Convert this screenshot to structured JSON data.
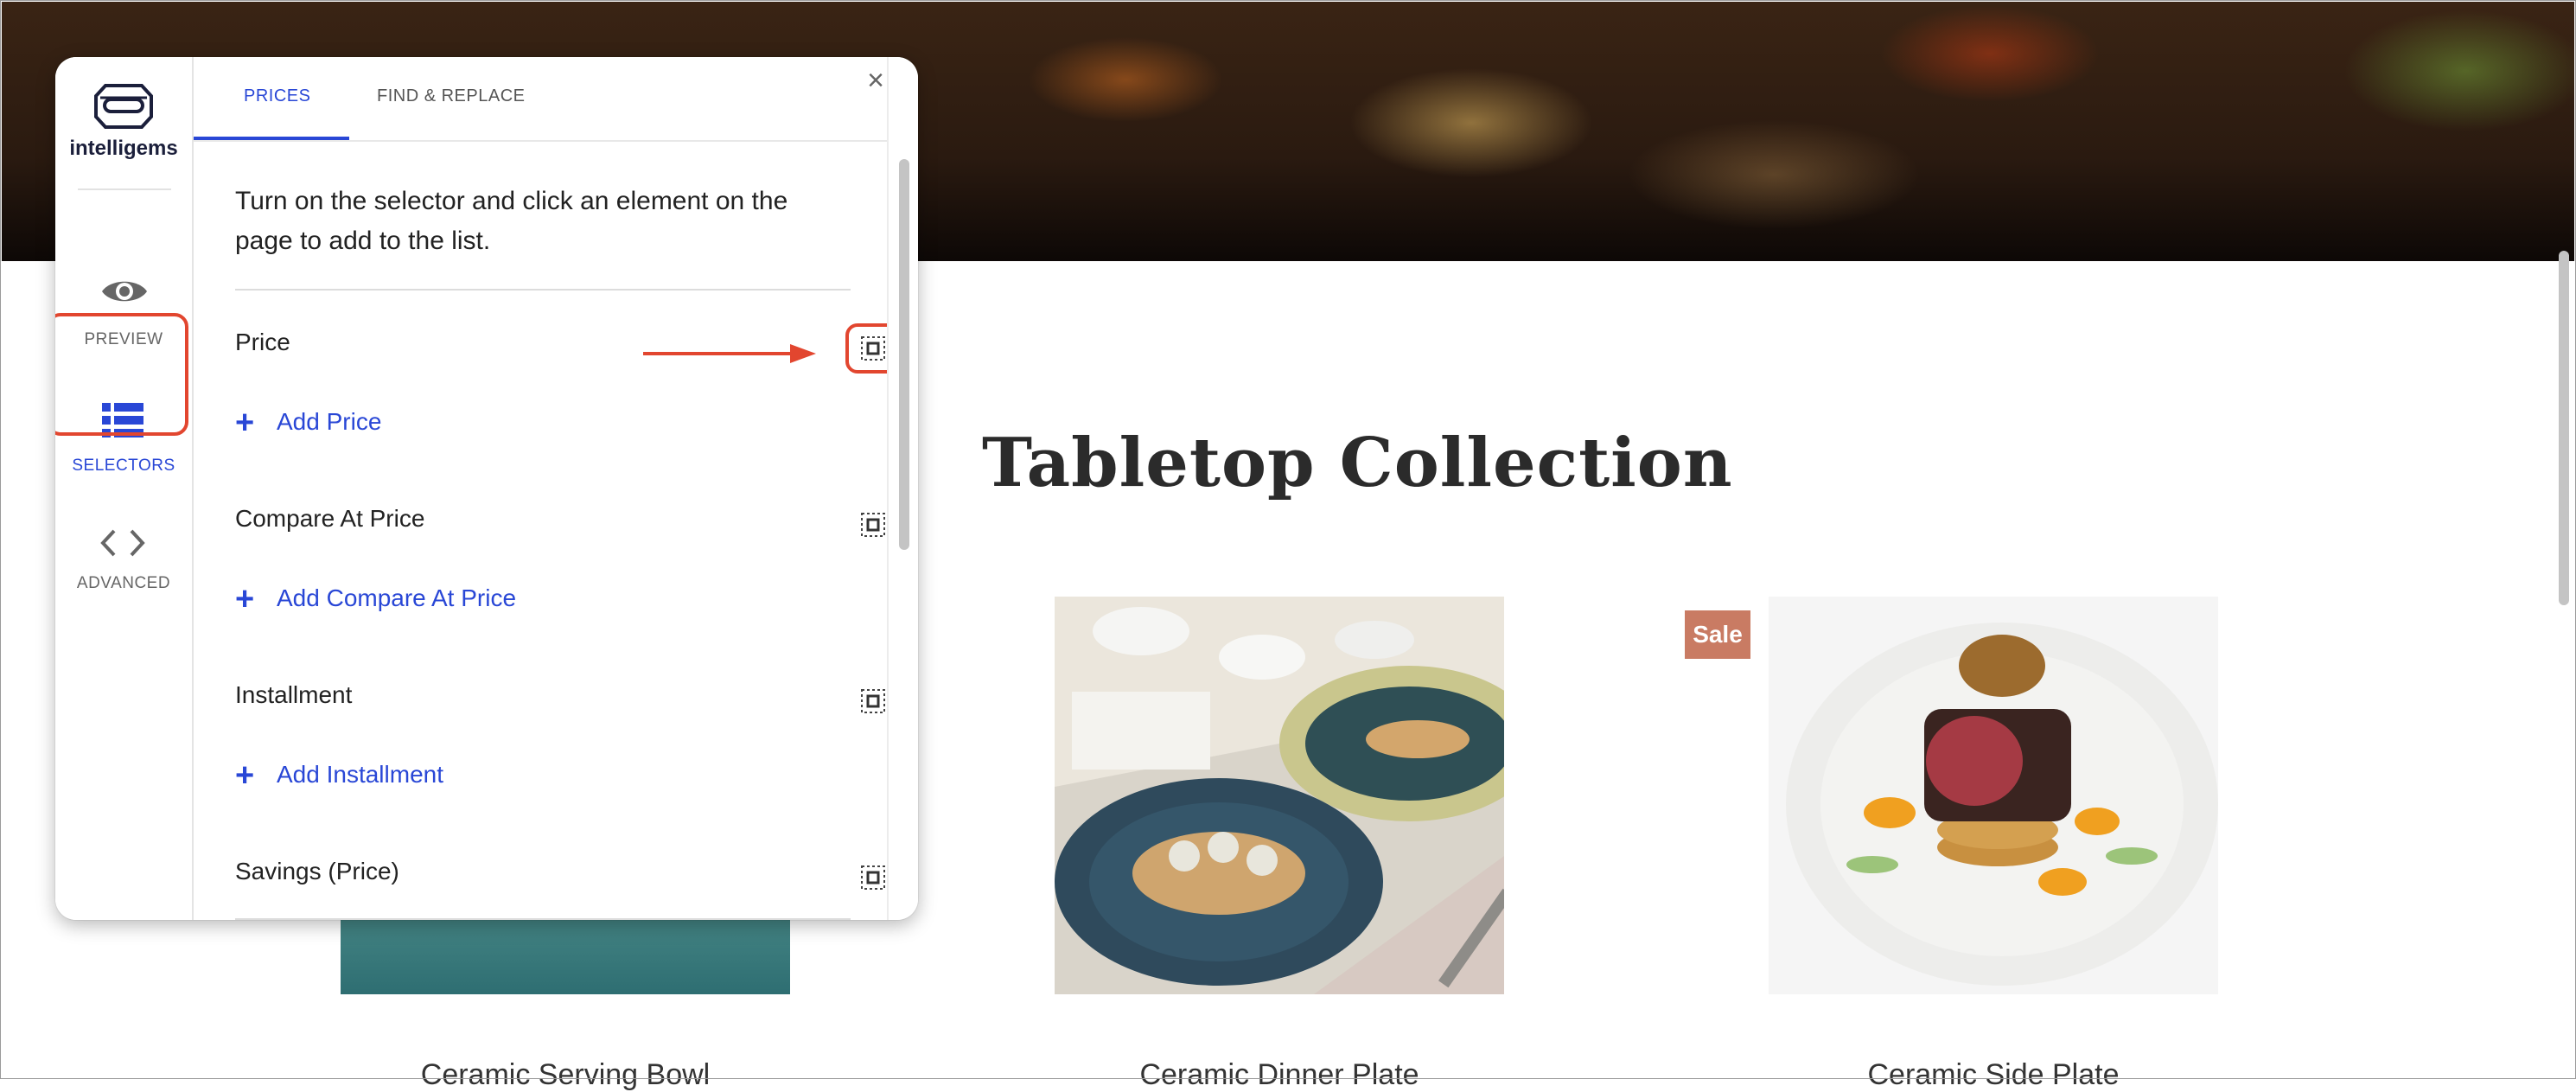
{
  "panel": {
    "logo_text": "intelligems",
    "nav": {
      "preview": "PREVIEW",
      "selectors": "SELECTORS",
      "advanced": "ADVANCED"
    },
    "tabs": {
      "prices": "PRICES",
      "find_replace": "FIND & REPLACE"
    },
    "close": "×",
    "instructions": "Turn on the selector and click an element on the page to add to the list.",
    "sections": [
      {
        "label": "Price",
        "add_label": "Add Price"
      },
      {
        "label": "Compare At Price",
        "add_label": "Add Compare At Price"
      },
      {
        "label": "Installment",
        "add_label": "Add Installment"
      },
      {
        "label": "Savings (Price)"
      }
    ],
    "add_plus": "+"
  },
  "page": {
    "collection_title": "Tabletop Collection",
    "products": [
      {
        "name": "Ceramic Serving Bowl"
      },
      {
        "name": "Ceramic Dinner Plate"
      },
      {
        "name": "Ceramic Side Plate",
        "badge": "Sale"
      }
    ]
  },
  "colors": {
    "accent_blue": "#2947d6",
    "highlight_red": "#e2462f",
    "sale_badge": "#c97b63"
  }
}
